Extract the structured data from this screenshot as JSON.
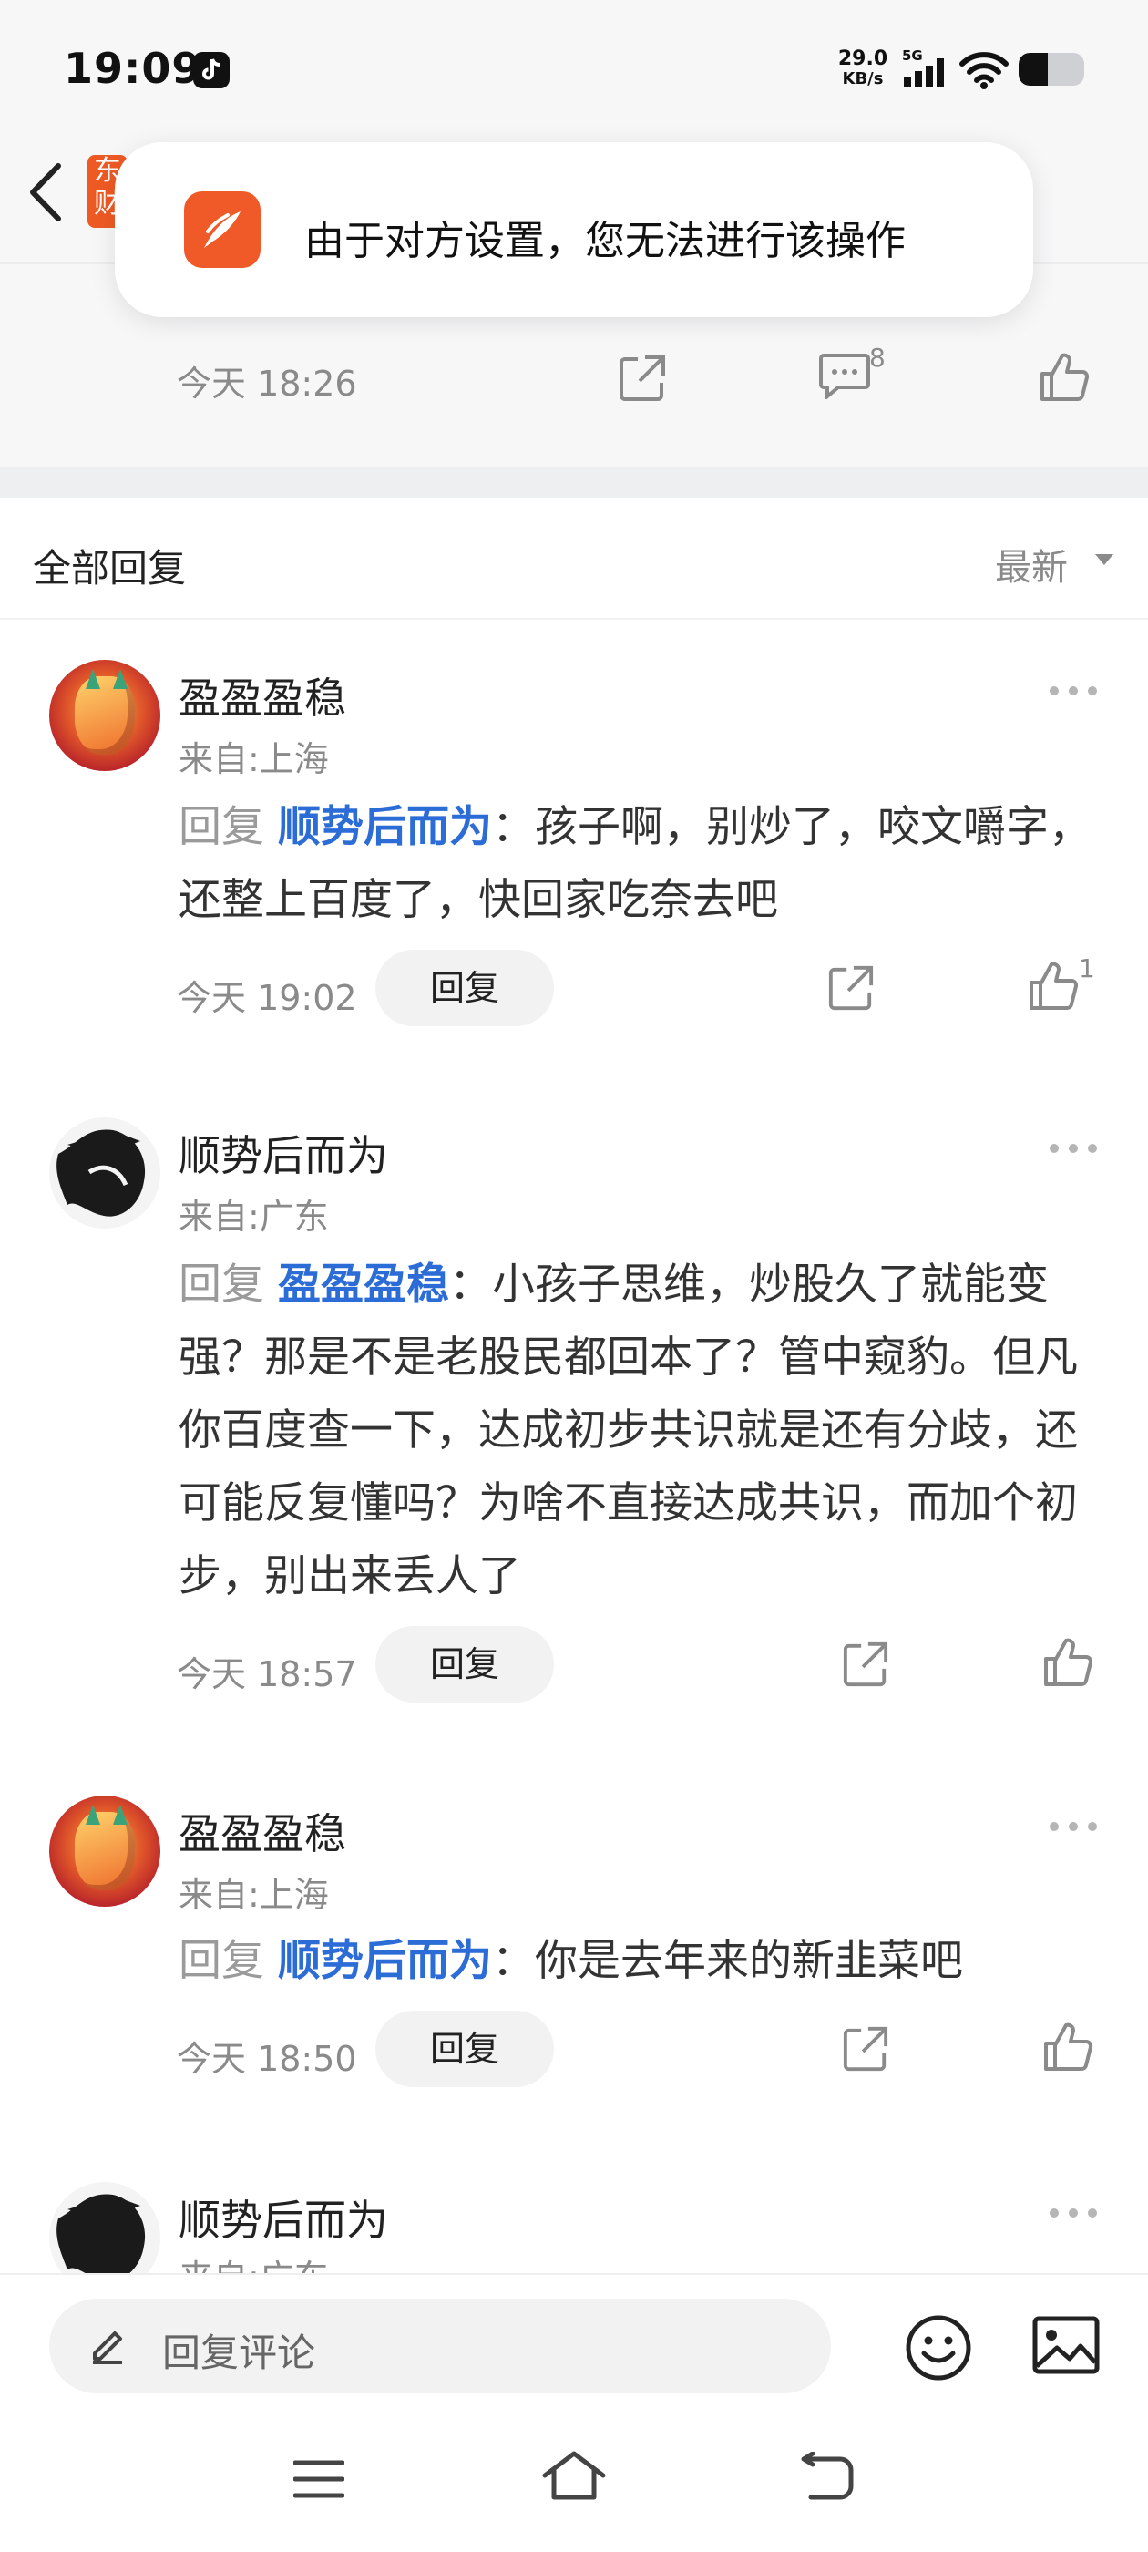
{
  "status_bar": {
    "time": "19:09",
    "net_speed_value": "29.0",
    "net_speed_unit": "KB/s",
    "network": "5G",
    "battery_level_percent": 45
  },
  "header": {
    "app_badge_text": "东财"
  },
  "toast": {
    "message": "由于对方设置，您无法进行该操作",
    "icon": "eastmoney-app-icon"
  },
  "post": {
    "time": "今天 18:26",
    "comment_count": "8"
  },
  "replies": {
    "section_title": "全部回复",
    "sort_label": "最新",
    "items": [
      {
        "username": "盈盈盈稳",
        "location": "来自:上海",
        "reply_word": "回复",
        "mention": "顺势后而为",
        "text": "：孩子啊，别炒了，咬文嚼字，还整上百度了，快回家吃奈去吧",
        "time": "今天 19:02",
        "reply_label": "回复",
        "likes": "1"
      },
      {
        "username": "顺势后而为",
        "location": "来自:广东",
        "reply_word": "回复",
        "mention": "盈盈盈稳",
        "text": "：小孩子思维，炒股久了就能变强？那是不是老股民都回本了？管中窥豹。但凡你百度查一下，达成初步共识就是还有分歧，还可能反复懂吗？为啥不直接达成共识，而加个初步，别出来丢人了",
        "time": "今天 18:57",
        "reply_label": "回复",
        "likes": ""
      },
      {
        "username": "盈盈盈稳",
        "location": "来自:上海",
        "reply_word": "回复",
        "mention": "顺势后而为",
        "text": "：你是去年来的新韭菜吧",
        "time": "今天 18:50",
        "reply_label": "回复",
        "likes": ""
      },
      {
        "username": "顺势后而为",
        "location": "来自:广东"
      }
    ]
  },
  "bottom_bar": {
    "reply_placeholder": "回复评论"
  },
  "colors": {
    "accent_blue": "#2c6cd6",
    "brand_orange": "#f05a28",
    "muted_text": "#8a8a8a"
  }
}
